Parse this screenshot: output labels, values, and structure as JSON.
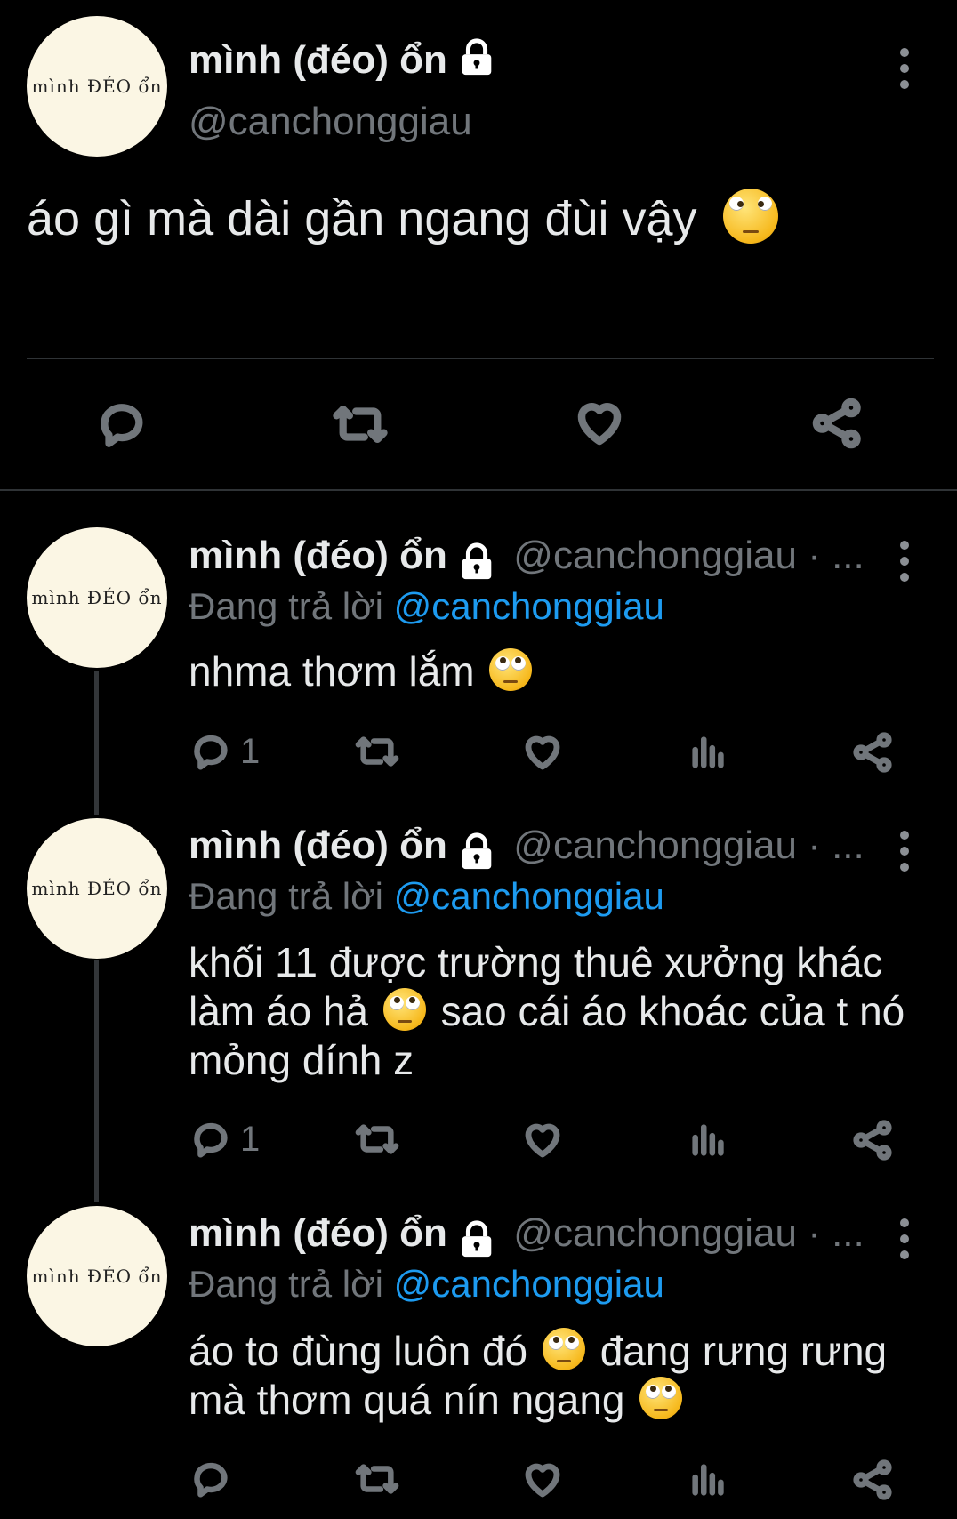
{
  "main_tweet": {
    "display_name": "mình (đéo) ổn",
    "handle": "@canchonggiau",
    "avatar_text": "mình ĐÉO ổn",
    "text": "áo gì mà dài gần ngang đùi vậy",
    "emoji": "face-with-rolling-eyes"
  },
  "replies": [
    {
      "display_name": "mình (đéo) ổn",
      "handle": "@canchonggiau · ...",
      "replying_prefix": "Đang trả lời",
      "replying_to": "@canchonggiau",
      "lines": [
        "nhma thơm lắm"
      ],
      "reply_count": "1"
    },
    {
      "display_name": "mình (đéo) ổn",
      "handle": "@canchonggiau · ...",
      "replying_prefix": "Đang trả lời",
      "replying_to": "@canchonggiau",
      "line1": "khối 11 được trường thuê xưởng khác",
      "line2a": "làm áo hả",
      "line2b": "sao cái áo khoác của t nó",
      "line3": "mỏng dính z",
      "reply_count": "1"
    },
    {
      "display_name": "mình (đéo) ổn",
      "handle": "@canchonggiau · ...",
      "replying_prefix": "Đang trả lời",
      "replying_to": "@canchonggiau",
      "line1a": "áo to đùng luôn đó",
      "line1b": "đang rưng rưng",
      "line2": "mà thơm quá nín ngang"
    }
  ],
  "colors": {
    "mention": "#1d9bf0",
    "muted": "#71767b",
    "text": "#e7e9ea",
    "avatar_bg": "#fbf6e4"
  }
}
